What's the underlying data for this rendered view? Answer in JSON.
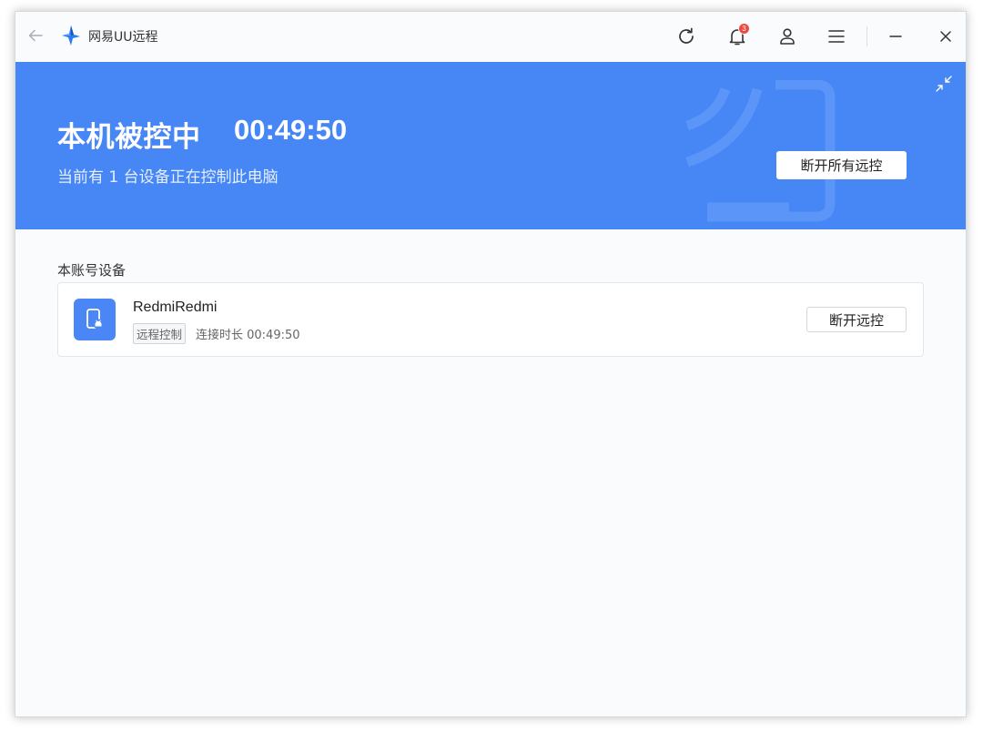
{
  "app": {
    "title": "网易UU远程",
    "notification_count": "3"
  },
  "banner": {
    "status_title": "本机被控中",
    "timer": "00:49:50",
    "subtitle": "当前有 1 台设备正在控制此电脑",
    "disconnect_all_label": "断开所有远控"
  },
  "devices": {
    "section_label": "本账号设备",
    "items": [
      {
        "name": "RedmiRedmi",
        "tag": "远程控制",
        "duration": "连接时长 00:49:50",
        "disconnect_label": "断开远控"
      }
    ]
  },
  "colors": {
    "accent": "#4686f5",
    "badge": "#f0483e"
  }
}
